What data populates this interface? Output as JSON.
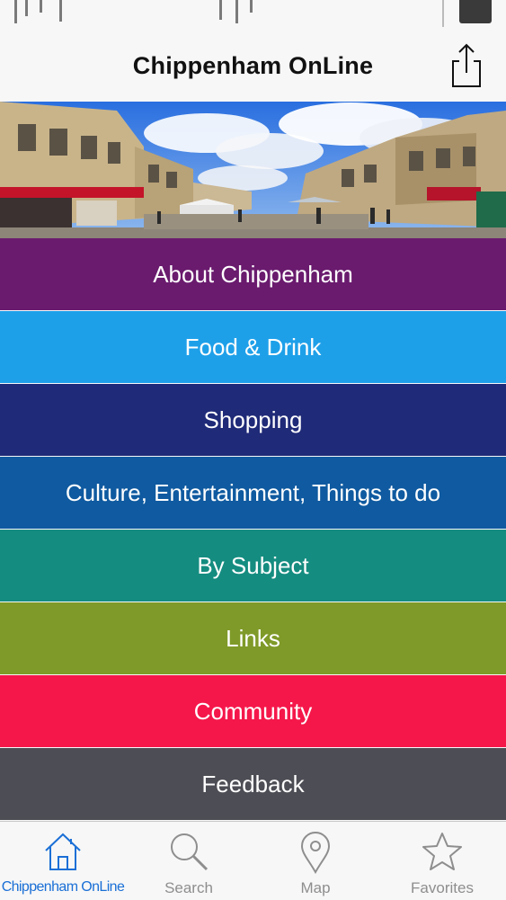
{
  "header": {
    "title": "Chippenham OnLine"
  },
  "menu": {
    "items": [
      {
        "label": "About Chippenham",
        "color": "#6a1b6e"
      },
      {
        "label": "Food & Drink",
        "color": "#1ea0e9"
      },
      {
        "label": "Shopping",
        "color": "#1f2a78"
      },
      {
        "label": "Culture, Entertainment, Things to do",
        "color": "#0f5aa0"
      },
      {
        "label": "By Subject",
        "color": "#158c80"
      },
      {
        "label": "Links",
        "color": "#7f9a28"
      },
      {
        "label": "Community",
        "color": "#f5174a"
      },
      {
        "label": "Feedback",
        "color": "#4d4d55"
      }
    ]
  },
  "tabbar": {
    "tabs": [
      {
        "label": "Chippenham OnLine",
        "icon": "home-icon",
        "active": true
      },
      {
        "label": "Search",
        "icon": "search-icon",
        "active": false
      },
      {
        "label": "Map",
        "icon": "map-pin-icon",
        "active": false
      },
      {
        "label": "Favorites",
        "icon": "star-icon",
        "active": false
      }
    ]
  },
  "colors": {
    "accent": "#1a6fd6",
    "inactive": "#8e8e8e"
  }
}
